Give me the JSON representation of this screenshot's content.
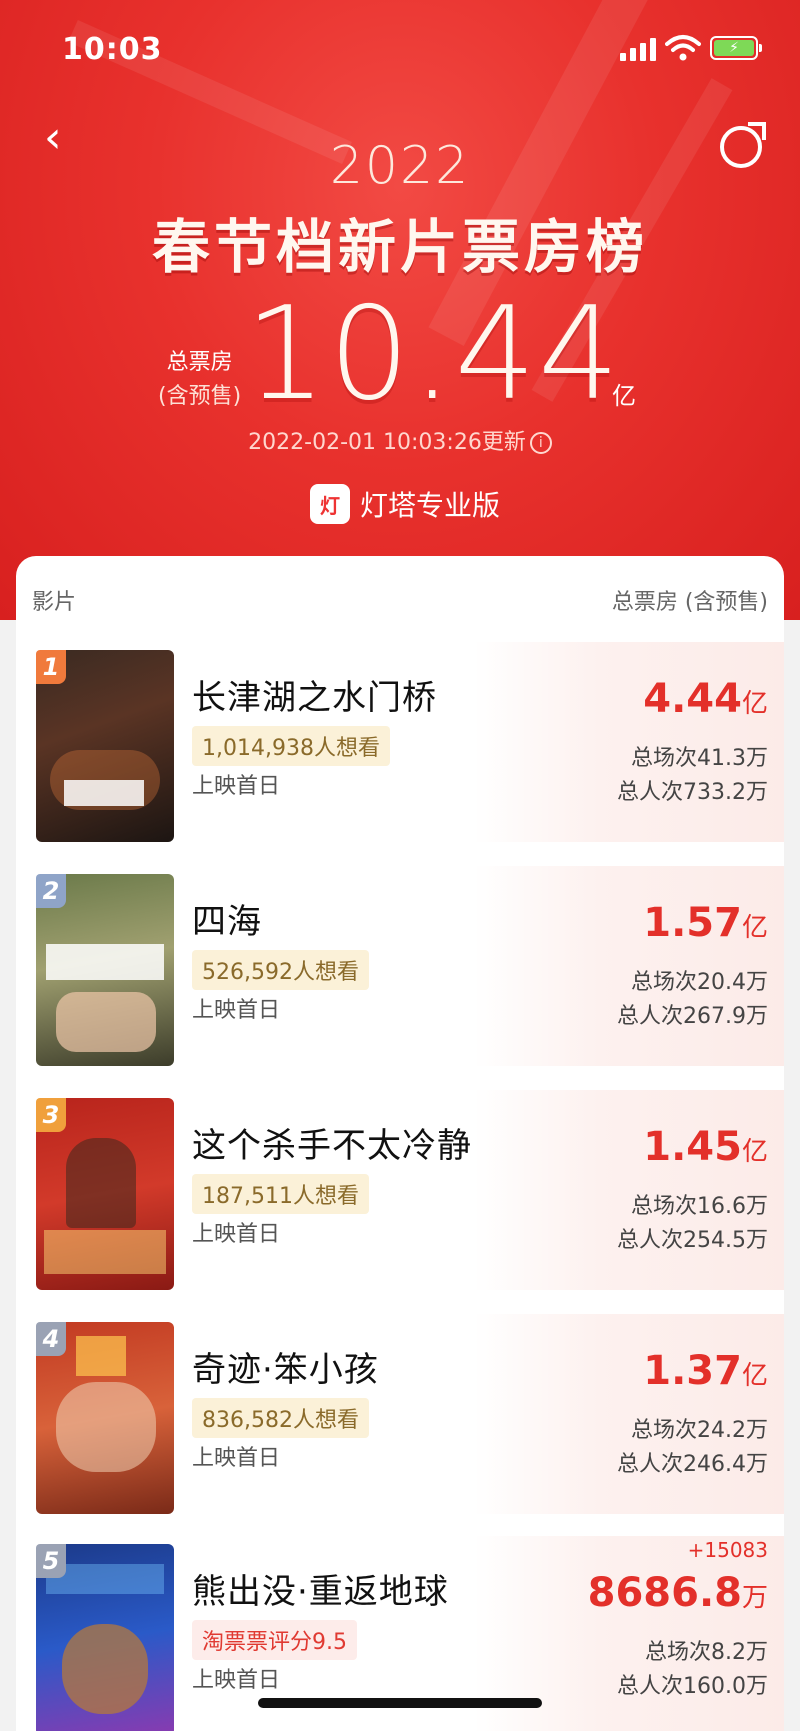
{
  "status": {
    "time": "10:03",
    "battery": "⚡"
  },
  "header": {
    "year": "2022",
    "title": "春节档新片票房榜",
    "total_label": "总票房",
    "total_sub": "(含预售)",
    "total_value": "10.44",
    "total_unit": "亿",
    "updated": "2022-02-01 10:03:26更新",
    "info_icon": "i",
    "brand": "灯塔专业版",
    "brand_logo": "灯"
  },
  "table": {
    "col_film": "影片",
    "col_box": "总票房 (含预售)"
  },
  "movies": [
    {
      "rank": "1",
      "name": "长津湖之水门桥",
      "tag": "1,014,938人想看",
      "first": "上映首日",
      "box": "4.44",
      "unit": "亿",
      "shows": "总场次41.3万",
      "viewers": "总人次733.2万",
      "delta": ""
    },
    {
      "rank": "2",
      "name": "四海",
      "tag": "526,592人想看",
      "first": "上映首日",
      "box": "1.57",
      "unit": "亿",
      "shows": "总场次20.4万",
      "viewers": "总人次267.9万",
      "delta": ""
    },
    {
      "rank": "3",
      "name": "这个杀手不太冷静",
      "tag": "187,511人想看",
      "first": "上映首日",
      "box": "1.45",
      "unit": "亿",
      "shows": "总场次16.6万",
      "viewers": "总人次254.5万",
      "delta": ""
    },
    {
      "rank": "4",
      "name": "奇迹·笨小孩",
      "tag": "836,582人想看",
      "first": "上映首日",
      "box": "1.37",
      "unit": "亿",
      "shows": "总场次24.2万",
      "viewers": "总人次246.4万",
      "delta": ""
    },
    {
      "rank": "5",
      "name": "熊出没·重返地球",
      "tag": "淘票票评分9.5",
      "first": "上映首日",
      "box": "8686.8",
      "unit": "万",
      "shows": "总场次8.2万",
      "viewers": "总人次160.0万",
      "delta": "+15083"
    }
  ],
  "colors": {
    "accent": "#e3302a",
    "hero": "#e8312d",
    "rank1": "#f07a3c",
    "rank2": "#8fa4c8",
    "rank3": "#f0a03c",
    "rank4": "#9aa2b4",
    "rank5": "#9aa2b4"
  }
}
